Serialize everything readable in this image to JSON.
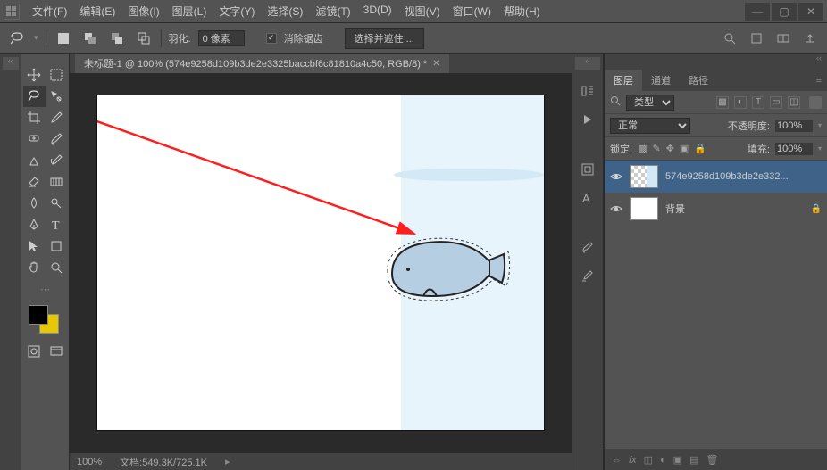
{
  "menu": {
    "file": "文件(F)",
    "edit": "编辑(E)",
    "image": "图像(I)",
    "layer": "图层(L)",
    "type": "文字(Y)",
    "select": "选择(S)",
    "filter": "滤镜(T)",
    "threed": "3D(D)",
    "view": "视图(V)",
    "window": "窗口(W)",
    "help": "帮助(H)"
  },
  "toolbar": {
    "feather_label": "羽化:",
    "feather_value": "0 像素",
    "antialias": "消除锯齿",
    "refine": "选择并遮住 ..."
  },
  "doc": {
    "tab_title": "未标题-1 @ 100% (574e9258d109b3de2e3325baccbf6c81810a4c50, RGB/8) *",
    "zoom": "100%",
    "filesize": "文档:549.3K/725.1K"
  },
  "panels": {
    "layers_tab": "图层",
    "channels_tab": "通道",
    "paths_tab": "路径",
    "kind_label": "类型",
    "blend_mode": "正常",
    "opacity_label": "不透明度:",
    "opacity_value": "100%",
    "lock_label": "锁定:",
    "fill_label": "填充:",
    "fill_value": "100%",
    "layer1_name": "574e9258d109b3de2e332...",
    "layer2_name": "背景"
  },
  "icons": {
    "search": "ρ"
  }
}
